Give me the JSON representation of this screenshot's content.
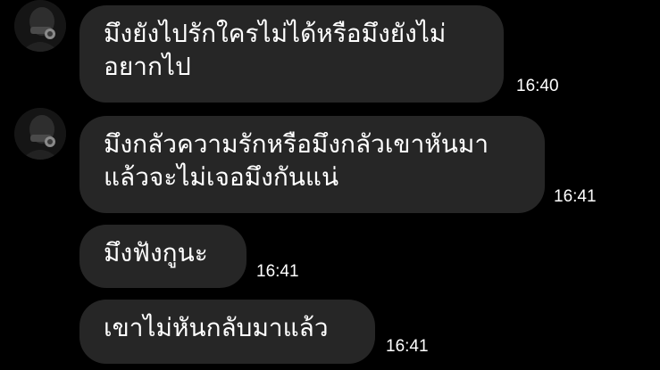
{
  "messages": [
    {
      "lines": [
        "มึงยังไปรักใครไม่ได้หรือมึงยังไม่",
        "อยากไป"
      ],
      "time": "16:40",
      "has_avatar": true
    },
    {
      "lines": [
        "มึงกลัวความรักหรือมึงกลัวเขาหันมา",
        "แล้วจะไม่เจอมึงกันแน่"
      ],
      "time": "16:41",
      "has_avatar": true
    },
    {
      "lines": [
        "มึงฟังกูนะ"
      ],
      "time": "16:41",
      "has_avatar": false
    },
    {
      "lines": [
        "เขาไม่หันกลับมาแล้ว"
      ],
      "time": "16:41",
      "has_avatar": false
    }
  ],
  "colors": {
    "background": "#000000",
    "bubble": "#262626",
    "text": "#ffffff"
  },
  "icons": {
    "avatar": "profile-photo"
  }
}
